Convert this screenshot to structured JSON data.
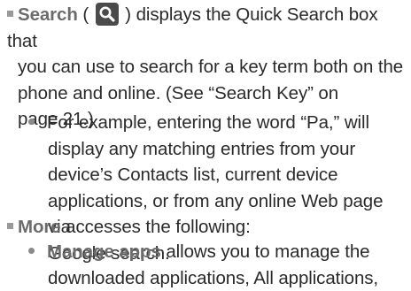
{
  "search_item": {
    "term": "Search",
    "open_paren": " ( ",
    "icon": "search-icon",
    "line1_rest": " ) displays the Quick Search box that",
    "line2": "you can use to search for a key term both on the",
    "line3": "phone and online. (See “Search Key” on",
    "line4": "page 21.)"
  },
  "example_item": {
    "line1": "For example, entering the word “Pa,” will",
    "line2": "display any matching entries from your",
    "line3": "device’s Contacts list, current device",
    "line4": "applications, or from any online Web page via",
    "line5": "Google search."
  },
  "more_item": {
    "term": "More",
    "rest": " accesses the following:"
  },
  "manage_item": {
    "term": "Manage apps",
    "line1_rest": " allows you to manage the",
    "line2": "downloaded applications, All applications,"
  },
  "colors": {
    "text": "#2a2a2a",
    "term": "#6c6c6c",
    "icon_bg": "#4a4a4a"
  }
}
